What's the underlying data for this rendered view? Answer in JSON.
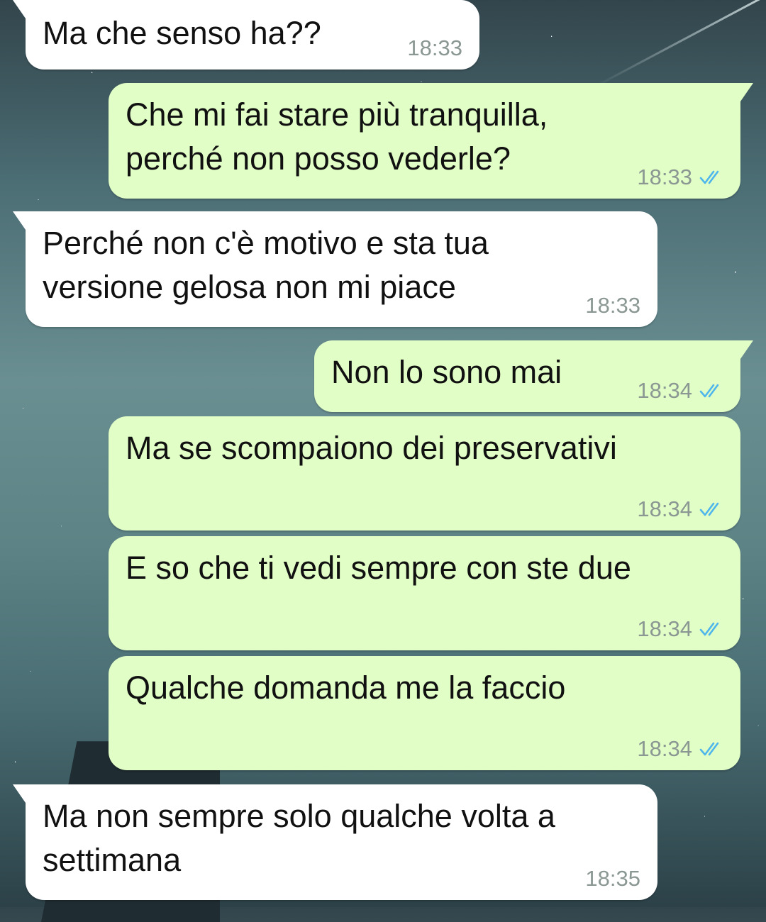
{
  "messages": [
    {
      "direction": "in",
      "text": "Ma che senso ha??",
      "time": "18:33"
    },
    {
      "direction": "out",
      "text": "Che mi fai stare più tranquilla,\nperché non posso vederle?",
      "time": "18:33",
      "status": "read"
    },
    {
      "direction": "in",
      "text": "Perché non c'è motivo e sta tua\nversione gelosa non mi piace",
      "time": "18:33"
    },
    {
      "direction": "out",
      "text": "Non lo sono mai",
      "time": "18:34",
      "status": "read"
    },
    {
      "direction": "out",
      "text": "Ma se scompaiono dei preservativi",
      "time": "18:34",
      "status": "read"
    },
    {
      "direction": "out",
      "text": "E so che ti vedi sempre con ste due",
      "time": "18:34",
      "status": "read"
    },
    {
      "direction": "out",
      "text": "Qualche domanda me la faccio",
      "time": "18:34",
      "status": "read"
    },
    {
      "direction": "in",
      "text": "Ma non sempre solo qualche volta a\nsettimana",
      "time": "18:35"
    }
  ],
  "colors": {
    "incoming_bubble": "#ffffff",
    "outgoing_bubble": "#e1fec6",
    "read_ticks": "#4fb6ec",
    "timestamp": "#8a9793"
  },
  "icons": {
    "read_status": "double-check-icon"
  }
}
